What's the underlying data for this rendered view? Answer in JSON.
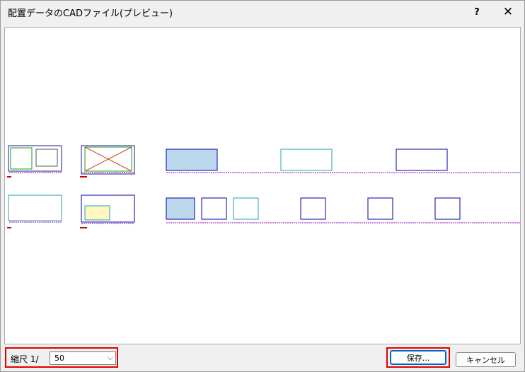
{
  "window": {
    "title": "配置データのCADファイル(プレビュー)"
  },
  "titlebar": {
    "help_icon": "?",
    "close_icon": "✕"
  },
  "scale": {
    "label": "縮尺 1/",
    "value": "50"
  },
  "buttons": {
    "save_label": "保存...",
    "cancel_label": "キャンセル"
  },
  "colors": {
    "accent": "#0067c0",
    "highlight": "#e00000"
  }
}
